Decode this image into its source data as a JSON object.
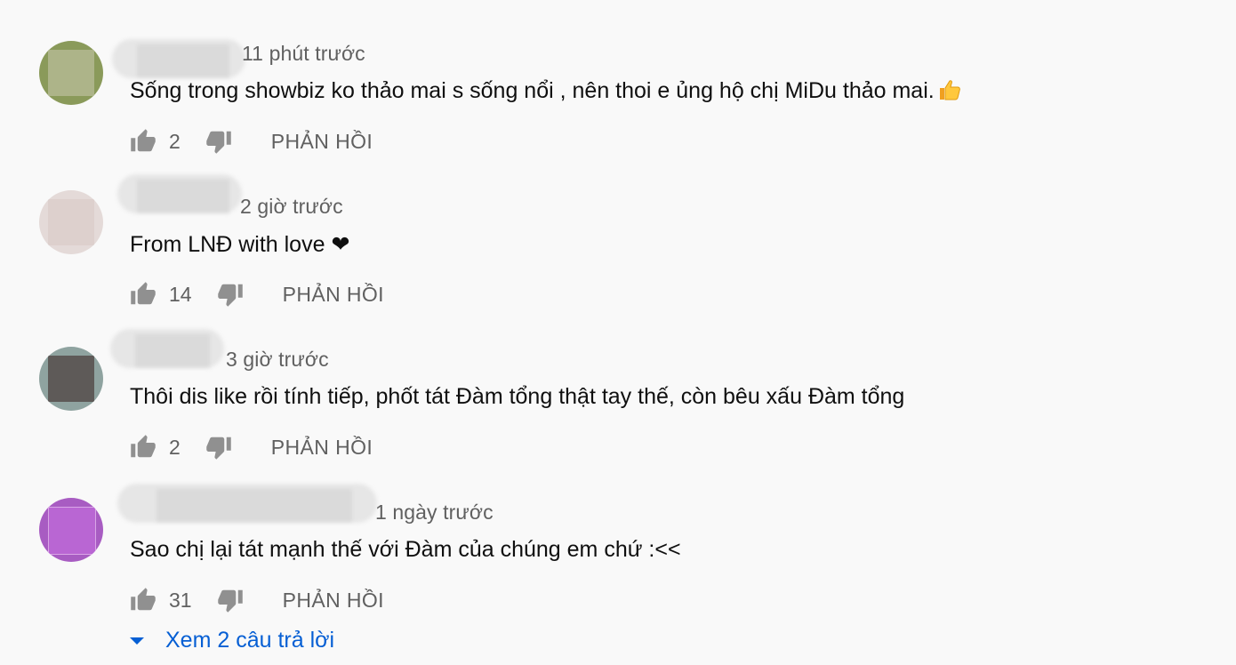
{
  "comments": [
    {
      "time": "11 phút trước",
      "text": "Sống trong showbiz ko thảo mai s sống nổi , nên thoi e ủng hộ chị MiDu thảo mai.",
      "emoji": "thumbs-up-emoji",
      "likes": "2",
      "reply_label": "PHẢN HỒI",
      "avatar_colors": {
        "ring": "#8a9a5a",
        "fill": "#adb489"
      }
    },
    {
      "time": "2 giờ trước",
      "text": "From LNĐ with love ❤",
      "likes": "14",
      "reply_label": "PHẢN HỒI",
      "avatar_colors": {
        "ring": "#d9c9c6",
        "fill": "#ddd0cd"
      }
    },
    {
      "time": "3 giờ trước",
      "text": "Thôi dis like rồi tính tiếp, phốt tát Đàm tổng thật tay thế, còn bêu xấu Đàm tổng",
      "likes": "2",
      "reply_label": "PHẢN HỒI",
      "avatar_colors": {
        "ring": "#7a8b88",
        "fill": "#5e5a58"
      }
    },
    {
      "time": "1 ngày trước",
      "text": "Sao chị lại tát mạnh thế với Đàm của chúng em chứ :<<",
      "likes": "31",
      "reply_label": "PHẢN HỒI",
      "avatar_colors": {
        "ring": "#a85cc2",
        "fill": "#b966d3"
      }
    }
  ],
  "view_replies": {
    "label": "Xem 2 câu trả lời",
    "icon": "caret-down-icon"
  },
  "colors": {
    "background": "#f9f9f9",
    "text": "#0f0f0f",
    "secondary": "#606060",
    "link": "#065fd4"
  }
}
